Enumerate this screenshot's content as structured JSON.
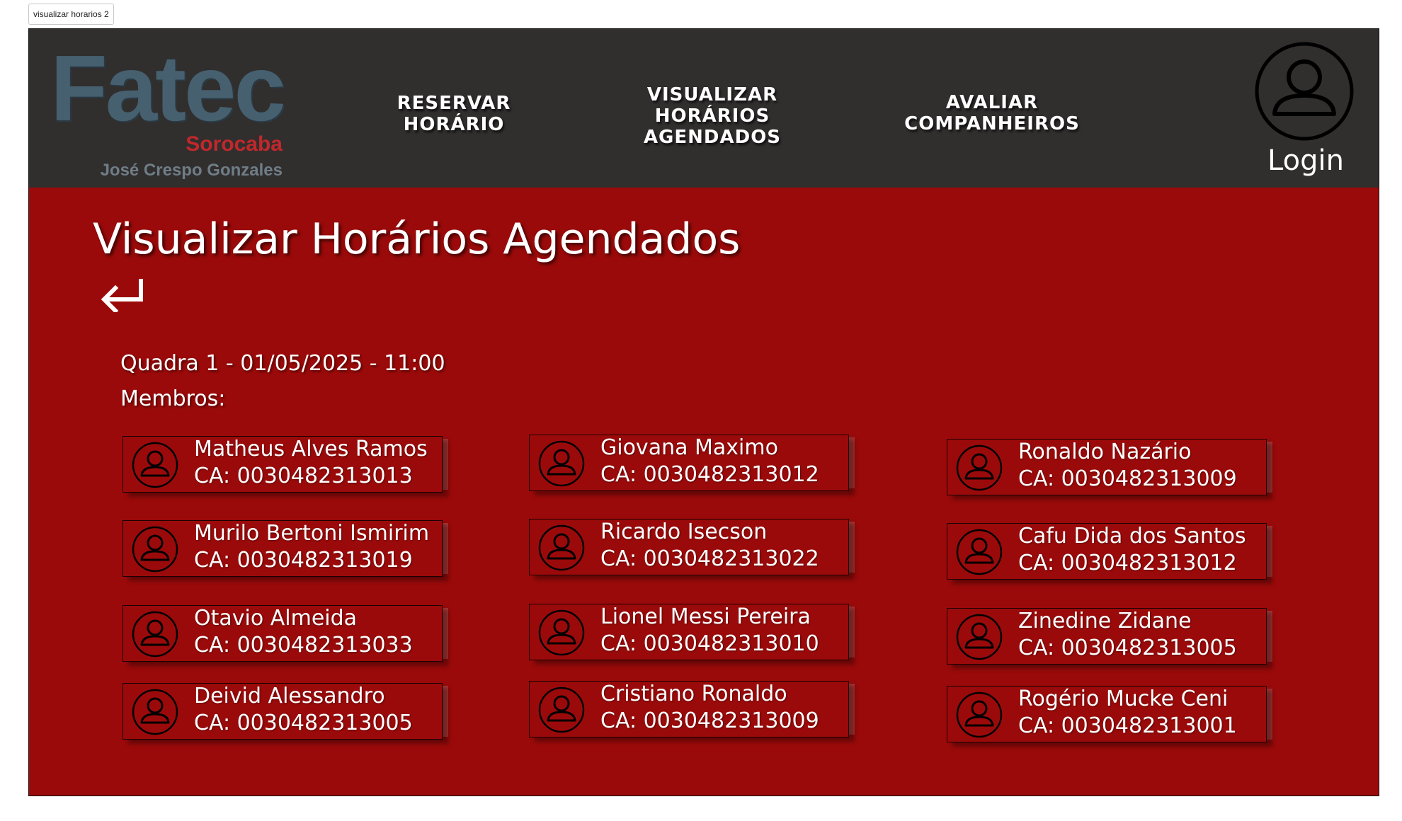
{
  "frame": {
    "label": "visualizar horarios 2"
  },
  "logo": {
    "brand": "Fatec",
    "city": "Sorocaba",
    "name": "José Crespo Gonzales"
  },
  "nav": {
    "reservar": "RESERVAR\nHORÁRIO",
    "visualizar": "VISUALIZAR\nHORÁRIOS\nAGENDADOS",
    "avaliar": "AVALIAR\nCOMPANHEIROS"
  },
  "login": {
    "label": "Login"
  },
  "page": {
    "title": "Visualizar Horários Agendados",
    "session": "Quadra 1 - 01/05/2025 - 11:00",
    "members_label": "Membros:"
  },
  "members": [
    {
      "name": "Matheus Alves Ramos",
      "ca": "CA: 0030482313013"
    },
    {
      "name": "Giovana Maximo",
      "ca": "CA: 0030482313012"
    },
    {
      "name": "Ronaldo Nazário",
      "ca": "CA: 0030482313009"
    },
    {
      "name": "Murilo Bertoni Ismirim",
      "ca": "CA: 0030482313019"
    },
    {
      "name": "Ricardo Isecson",
      "ca": "CA: 0030482313022"
    },
    {
      "name": "Cafu Dida dos Santos",
      "ca": "CA: 0030482313012"
    },
    {
      "name": "Otavio Almeida",
      "ca": "CA: 0030482313033"
    },
    {
      "name": "Lionel Messi Pereira",
      "ca": "CA: 0030482313010"
    },
    {
      "name": "Zinedine Zidane",
      "ca": "CA: 0030482313005"
    },
    {
      "name": "Deivid Alessandro",
      "ca": "CA: 0030482313005"
    },
    {
      "name": "Cristiano Ronaldo",
      "ca": "CA: 0030482313009"
    },
    {
      "name": "Rogério Mucke Ceni",
      "ca": "CA: 0030482313001"
    }
  ],
  "colors": {
    "header_bg": "#312e2e",
    "page_bg": "#9b0a0a",
    "logo_blue": "#46606f",
    "logo_red": "#c0282b"
  }
}
